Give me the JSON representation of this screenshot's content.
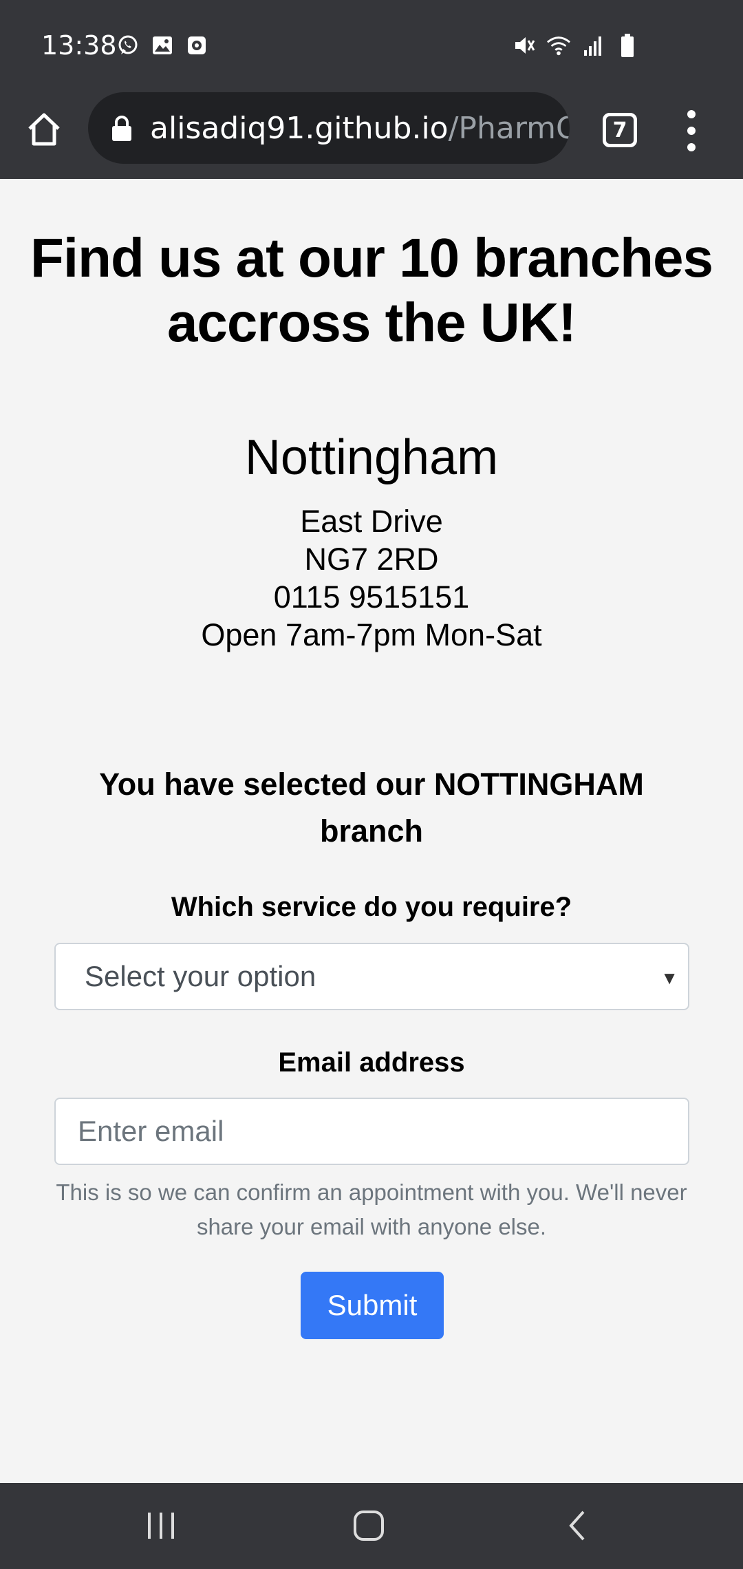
{
  "status_bar": {
    "time": "13:38",
    "left_icons": [
      "whatsapp-icon",
      "gallery-icon",
      "screen-recorder-icon"
    ],
    "right_icons": [
      "mute-icon",
      "wifi-icon",
      "signal-icon",
      "battery-icon"
    ]
  },
  "browser": {
    "url_host": "alisadiq91.github.io",
    "url_path": "/PharmO",
    "tab_count": "7"
  },
  "page": {
    "headline": "Find us at our 10 branches accross the UK!",
    "branch": {
      "name": "Nottingham",
      "street": "East Drive",
      "postcode": "NG7 2RD",
      "phone": "0115 9515151",
      "hours": "Open 7am-7pm Mon-Sat"
    },
    "selected_text": "You have selected our NOTTINGHAM branch",
    "service_label": "Which service do you require?",
    "service_select_value": "Select your option",
    "email_label": "Email address",
    "email_placeholder": "Enter email",
    "email_value": "",
    "help_text": "This is so we can confirm an appointment with you. We'll never share your email with anyone else.",
    "submit_label": "Submit"
  },
  "colors": {
    "chrome_bar": "#35363a",
    "url_pill": "#202124",
    "submit": "#3478f6",
    "page_bg": "#f4f4f4"
  }
}
